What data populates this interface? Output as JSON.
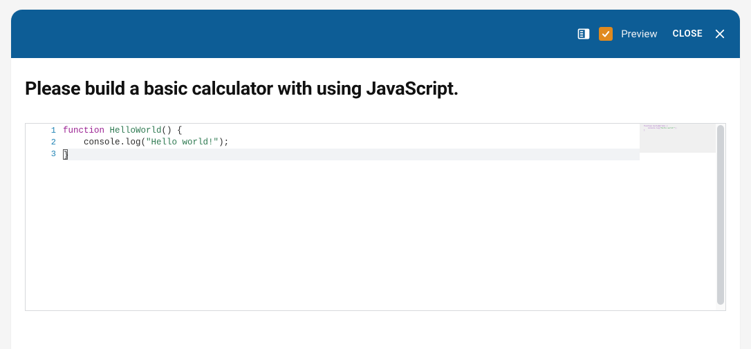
{
  "header": {
    "preview_label": "Preview",
    "close_label": "CLOSE",
    "preview_checked": true
  },
  "title": "Please build a basic calculator with using JavaScript.",
  "editor": {
    "line_numbers": [
      "1",
      "2",
      "3"
    ],
    "lines": [
      {
        "tokens": [
          {
            "t": "function",
            "c": "tok-keyword"
          },
          {
            "t": " ",
            "c": ""
          },
          {
            "t": "HelloWorld",
            "c": "tok-funcname"
          },
          {
            "t": "() {",
            "c": "tok-punc"
          }
        ]
      },
      {
        "tokens": [
          {
            "t": "    console.log(",
            "c": "tok-punc"
          },
          {
            "t": "\"Hello world!\"",
            "c": "tok-string"
          },
          {
            "t": ");",
            "c": "tok-punc"
          }
        ]
      },
      {
        "tokens": [
          {
            "t": "}",
            "c": "tok-punc",
            "cursor": true
          }
        ],
        "current": true
      }
    ],
    "plain_text": "function HelloWorld() {\n    console.log(\"Hello world!\");\n}"
  }
}
